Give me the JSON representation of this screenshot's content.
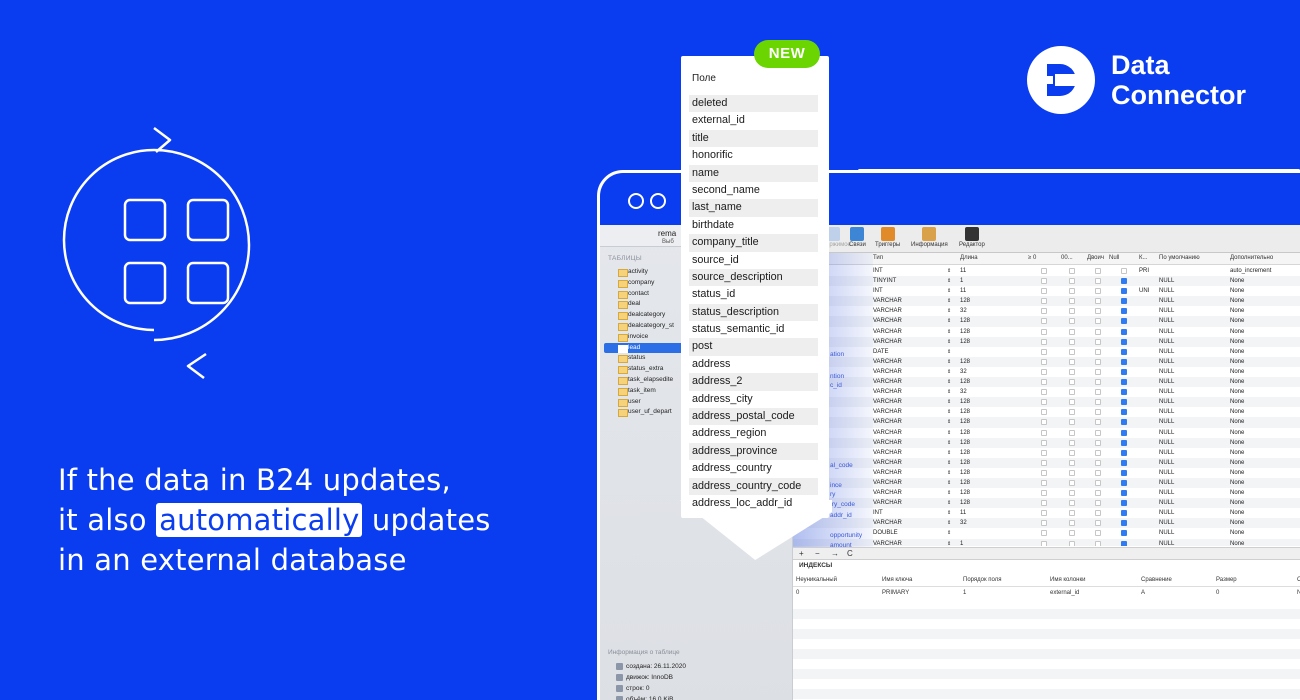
{
  "headline": {
    "line1": "If the data in B24 updates,",
    "line2_before": "it also ",
    "line2_highlight": "automatically",
    "line2_after": " updates",
    "line3": "in an external database"
  },
  "brand": {
    "line1": "Data",
    "line2": "Connector"
  },
  "badge": "NEW",
  "popup": {
    "header": "Поле",
    "fields": [
      "deleted",
      "external_id",
      "title",
      "honorific",
      "name",
      "second_name",
      "last_name",
      "birthdate",
      "company_title",
      "source_id",
      "source_description",
      "status_id",
      "status_description",
      "status_semantic_id",
      "post",
      "address",
      "address_2",
      "address_city",
      "address_postal_code",
      "address_region",
      "address_province",
      "address_country",
      "address_country_code",
      "address_loc_addr_id"
    ]
  },
  "app": {
    "sidebar_title": "rema",
    "sidebar_sub": "Выб",
    "tables_label": "ТАБЛИЦЫ",
    "tables": [
      "activity",
      "company",
      "contact",
      "deal",
      "dealcategory",
      "dealcategory_st",
      "invoice",
      "lead",
      "status",
      "status_extra",
      "task_elapsedite",
      "task_item",
      "user",
      "user_uf_depart"
    ],
    "selected_table": "lead",
    "info_label": "Информация о таблице",
    "info": [
      "создана: 26.11.2020",
      "движок: InnoDB",
      "строк: 0",
      "объём: 16,0 KiB"
    ],
    "toolbar": [
      "Содержимое",
      "Связи",
      "Триггеры",
      "Информация",
      "Редактор"
    ],
    "columns": [
      "Тип",
      "Длина",
      "≥ 0",
      "00...",
      "Двоич",
      "Null",
      "К...",
      "По умолчанию",
      "Дополнительно"
    ],
    "ghost_labels": [
      "ation",
      "ntion",
      "c_id",
      "al_code",
      "ince",
      "ry",
      "try_code",
      "addr_id",
      "opportunity",
      "amount"
    ],
    "rows": [
      {
        "type": "INT",
        "len": "11",
        "null": false,
        "key": "PRI",
        "def": "",
        "extra": "auto_increment"
      },
      {
        "type": "TINYINT",
        "len": "1",
        "null": true,
        "key": "",
        "def": "NULL",
        "extra": "None"
      },
      {
        "type": "INT",
        "len": "11",
        "null": true,
        "key": "UNI",
        "def": "NULL",
        "extra": "None"
      },
      {
        "type": "VARCHAR",
        "len": "128",
        "null": true,
        "key": "",
        "def": "NULL",
        "extra": "None"
      },
      {
        "type": "VARCHAR",
        "len": "32",
        "null": true,
        "key": "",
        "def": "NULL",
        "extra": "None"
      },
      {
        "type": "VARCHAR",
        "len": "128",
        "null": true,
        "key": "",
        "def": "NULL",
        "extra": "None"
      },
      {
        "type": "VARCHAR",
        "len": "128",
        "null": true,
        "key": "",
        "def": "NULL",
        "extra": "None"
      },
      {
        "type": "VARCHAR",
        "len": "128",
        "null": true,
        "key": "",
        "def": "NULL",
        "extra": "None"
      },
      {
        "type": "DATE",
        "len": "",
        "null": true,
        "key": "",
        "def": "NULL",
        "extra": "None"
      },
      {
        "type": "VARCHAR",
        "len": "128",
        "null": true,
        "key": "",
        "def": "NULL",
        "extra": "None"
      },
      {
        "type": "VARCHAR",
        "len": "32",
        "null": true,
        "key": "",
        "def": "NULL",
        "extra": "None"
      },
      {
        "type": "VARCHAR",
        "len": "128",
        "null": true,
        "key": "",
        "def": "NULL",
        "extra": "None"
      },
      {
        "type": "VARCHAR",
        "len": "32",
        "null": true,
        "key": "",
        "def": "NULL",
        "extra": "None"
      },
      {
        "type": "VARCHAR",
        "len": "128",
        "null": true,
        "key": "",
        "def": "NULL",
        "extra": "None"
      },
      {
        "type": "VARCHAR",
        "len": "128",
        "null": true,
        "key": "",
        "def": "NULL",
        "extra": "None"
      },
      {
        "type": "VARCHAR",
        "len": "128",
        "null": true,
        "key": "",
        "def": "NULL",
        "extra": "None"
      },
      {
        "type": "VARCHAR",
        "len": "128",
        "null": true,
        "key": "",
        "def": "NULL",
        "extra": "None"
      },
      {
        "type": "VARCHAR",
        "len": "128",
        "null": true,
        "key": "",
        "def": "NULL",
        "extra": "None"
      },
      {
        "type": "VARCHAR",
        "len": "128",
        "null": true,
        "key": "",
        "def": "NULL",
        "extra": "None"
      },
      {
        "type": "VARCHAR",
        "len": "128",
        "null": true,
        "key": "",
        "def": "NULL",
        "extra": "None"
      },
      {
        "type": "VARCHAR",
        "len": "128",
        "null": true,
        "key": "",
        "def": "NULL",
        "extra": "None"
      },
      {
        "type": "VARCHAR",
        "len": "128",
        "null": true,
        "key": "",
        "def": "NULL",
        "extra": "None"
      },
      {
        "type": "VARCHAR",
        "len": "128",
        "null": true,
        "key": "",
        "def": "NULL",
        "extra": "None"
      },
      {
        "type": "VARCHAR",
        "len": "128",
        "null": true,
        "key": "",
        "def": "NULL",
        "extra": "None"
      },
      {
        "type": "INT",
        "len": "11",
        "null": true,
        "key": "",
        "def": "NULL",
        "extra": "None"
      },
      {
        "type": "VARCHAR",
        "len": "32",
        "null": true,
        "key": "",
        "def": "NULL",
        "extra": "None"
      },
      {
        "type": "DOUBLE",
        "len": "",
        "null": true,
        "key": "",
        "def": "NULL",
        "extra": "None"
      },
      {
        "type": "VARCHAR",
        "len": "1",
        "null": true,
        "key": "",
        "def": "NULL",
        "extra": "None"
      }
    ],
    "index_controls": [
      "+",
      "−",
      "→",
      "C"
    ],
    "index_title": "ИНДЕКСЫ",
    "index_columns": [
      "Неуникальный",
      "Имя ключа",
      "Порядок поля",
      "Имя колонки",
      "Сравнение",
      "Размер",
      "С"
    ],
    "index_row": [
      "0",
      "PRIMARY",
      "1",
      "external_id",
      "A",
      "0",
      "N"
    ]
  },
  "colors": {
    "background": "#0a3cf0",
    "badge": "#6ad500",
    "selection": "#2b6ee6",
    "checkbox": "#2f7bf2"
  }
}
